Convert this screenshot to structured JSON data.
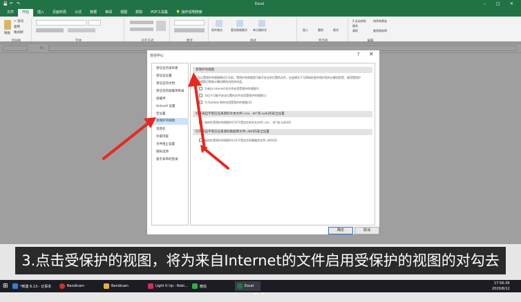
{
  "window": {
    "title": "Excel",
    "controls": [
      "–",
      "□",
      "✕"
    ]
  },
  "quick_access": [
    "💾",
    "↶",
    "↷"
  ],
  "tabs": [
    {
      "label": "文件"
    },
    {
      "label": "开始",
      "active": true
    },
    {
      "label": "插入"
    },
    {
      "label": "页面布局"
    },
    {
      "label": "公式"
    },
    {
      "label": "数据"
    },
    {
      "label": "审阅"
    },
    {
      "label": "视图"
    },
    {
      "label": "帮助"
    },
    {
      "label": "PDF工具集"
    },
    {
      "label": "操作说明搜索",
      "icon": "lightbulb-icon"
    }
  ],
  "ribbon": {
    "clipboard": {
      "label": "剪贴板",
      "paste": "粘贴",
      "cut": "✂ 剪切",
      "copy": "复制",
      "format": "格式刷"
    },
    "font": {
      "label": "字体"
    },
    "alignment": {
      "label": "对齐方式"
    },
    "number": {
      "label": "数字"
    },
    "styles": {
      "label": "样式",
      "cond": "条件格式",
      "table": "套用表格格式",
      "cell": "单元格样式"
    },
    "cells": {
      "label": "单元格",
      "insert": "插入",
      "delete": "删除",
      "format": "格式"
    },
    "editing": {
      "label": "编辑",
      "sum": "Σ 自动求和",
      "fill": "填充",
      "clear": "清除",
      "sort": "排序和筛选",
      "find": "查找和选择"
    }
  },
  "formula_bar": {
    "fx": "fx"
  },
  "dialog": {
    "title": "信任中心",
    "help": "?",
    "close": "✕",
    "nav": [
      {
        "label": "受信任的发布者"
      },
      {
        "label": "受信任位置"
      },
      {
        "label": "受信任的文档"
      },
      {
        "label": "受信任的加载项目录"
      },
      {
        "label": "加载项"
      },
      {
        "label": "ActiveX 设置"
      },
      {
        "label": "宏设置"
      },
      {
        "label": "受保护的视图",
        "selected": true
      },
      {
        "label": "消息栏"
      },
      {
        "label": "外部内容"
      },
      {
        "label": "文件阻止设置"
      },
      {
        "label": "隐私选项"
      },
      {
        "label": "基于表单的登录"
      }
    ],
    "protected_view": {
      "heading": "受保护的视图",
      "description_1": "在以受保护的视图模式打开前，受保护的视图是可能不安全的位置的文件，在此模式下可帮助检查并保护您的计算机免受，使用受保护",
      "description_2": "的视图可帮助计算机降低风险的机会。",
      "options": [
        {
          "label": "为来自 Internet 的文件启用受保护的视图(I)",
          "checked": false
        },
        {
          "label": "为位于可能不安全位置的文件启用受保护的视图(L)",
          "checked": false
        },
        {
          "label": "为 Outlook 附件启用受保护的视图(O)",
          "checked": false
        }
      ]
    },
    "section2": {
      "heading": "打开来自不受信任来源的文本文件(.csv, .dif 和.sylk)的安全设置",
      "option": "始终在受保护的视图中打开不受信任的文本文件(.csv、.dif 和.sylk)(E)"
    },
    "section3": {
      "heading": "打开来自不受信任来源的数据库文件(.dbf)的安全设置",
      "option": "始终在受保护的视图中打开不受信任的数据库文件(.dbf)(D)"
    },
    "ok": "确定",
    "cancel": "取消"
  },
  "caption": "3.点击受保护的视图，将为来自Internet的文件启用受保护的视图的对勾去掉",
  "taskbar": {
    "items": [
      {
        "label": "*新建 6.13 - 记事本",
        "color": "#3a7bd5"
      },
      {
        "label": "Bandicam",
        "color": "#d03030"
      },
      {
        "label": "Bandicam",
        "color": "#e0b050"
      },
      {
        "label": "Light It Up - Robi...",
        "color": "#c8325a"
      },
      {
        "label": "微信",
        "color": "#2fae45"
      },
      {
        "label": "Excel",
        "color": "#217346"
      }
    ],
    "time": "17:56:39",
    "date": "2020/6/12"
  }
}
